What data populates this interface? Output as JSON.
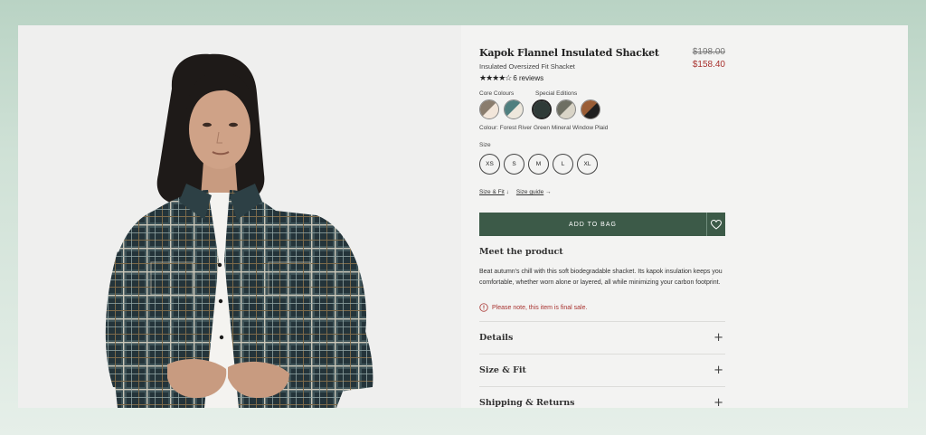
{
  "product": {
    "title": "Kapok Flannel Insulated Shacket",
    "subtitle": "Insulated Oversized Fit Shacket",
    "price_original": "$198.00",
    "price_sale": "$158.40",
    "rating_stars": "★★★★☆",
    "rating_value": 4.5,
    "reviews": "6 reviews"
  },
  "swatch_groups": {
    "core_label": "Core Colours",
    "special_label": "Special Editions"
  },
  "swatches": [
    {
      "name": "core-1",
      "a": "#8a7d6e",
      "b": "#f2e6da",
      "selected": false
    },
    {
      "name": "core-2",
      "a": "#4f7f7f",
      "b": "#ede7dc",
      "selected": false
    },
    {
      "name": "special-1",
      "a": "#2f3b38",
      "b": "#2f3b38",
      "selected": true
    },
    {
      "name": "special-2",
      "a": "#6e6f63",
      "b": "#d9d4c7",
      "selected": false
    },
    {
      "name": "special-3",
      "a": "#9a5d36",
      "b": "#1f1f1f",
      "selected": false
    }
  ],
  "colour_text": "Colour: Forest River Green Mineral Window Plaid",
  "size": {
    "label": "Size",
    "options": [
      "XS",
      "S",
      "M",
      "L",
      "XL"
    ]
  },
  "links": {
    "size_fit": "Size & Fit",
    "size_fit_arrow": "↓",
    "size_guide": "Size guide",
    "size_guide_arrow": "→"
  },
  "cart": {
    "add_label": "ADD TO BAG",
    "wishlist_icon": "heart-icon"
  },
  "meet": {
    "heading": "Meet the product",
    "description": "Beat autumn's chill with this soft biodegradable shacket. Its kapok insulation keeps you comfortable, whether worn alone or layered, all while minimizing your carbon footprint.",
    "notice": "Please note, this item is final sale."
  },
  "accordion": [
    {
      "label": "Details",
      "icon": "+"
    },
    {
      "label": "Size & Fit",
      "icon": "+"
    },
    {
      "label": "Shipping & Returns",
      "icon": "+"
    }
  ],
  "colors": {
    "accent_green": "#3c5a48",
    "sale_red": "#a8322f",
    "background": "#f3f3f2"
  }
}
